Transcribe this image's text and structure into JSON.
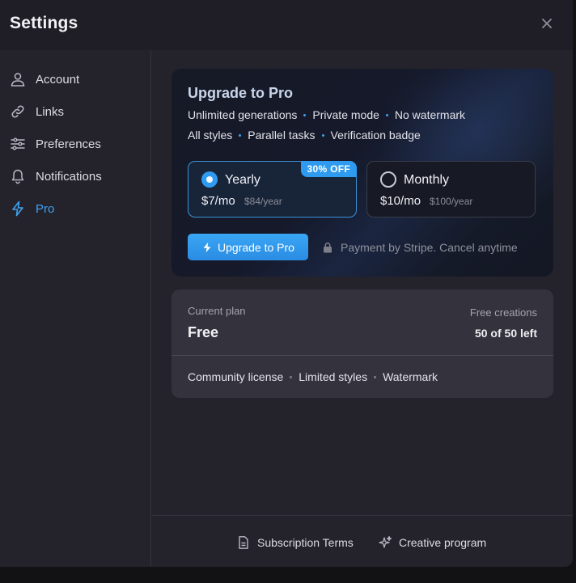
{
  "window": {
    "title": "Settings"
  },
  "sidebar": {
    "items": [
      {
        "label": "Account",
        "icon": "user-icon"
      },
      {
        "label": "Links",
        "icon": "link-icon"
      },
      {
        "label": "Preferences",
        "icon": "sliders-icon"
      },
      {
        "label": "Notifications",
        "icon": "bell-icon"
      },
      {
        "label": "Pro",
        "icon": "lightning-icon",
        "active": true
      }
    ]
  },
  "upgrade": {
    "title": "Upgrade to Pro",
    "features_row1": [
      "Unlimited generations",
      "Private mode",
      "No watermark"
    ],
    "features_row2": [
      "All styles",
      "Parallel tasks",
      "Verification badge"
    ],
    "plans": {
      "yearly": {
        "name": "Yearly",
        "price": "$7/mo",
        "year": "$84/year",
        "badge": "30% OFF",
        "selected": true
      },
      "monthly": {
        "name": "Monthly",
        "price": "$10/mo",
        "year": "$100/year",
        "selected": false
      }
    },
    "button_label": "Upgrade to Pro",
    "payment_note": "Payment by Stripe. Cancel anytime"
  },
  "current_plan": {
    "label": "Current plan",
    "name": "Free",
    "free_label": "Free creations",
    "free_count": "50 of 50 left",
    "features": [
      "Community license",
      "Limited styles",
      "Watermark"
    ]
  },
  "footer": {
    "terms_label": "Subscription Terms",
    "creative_label": "Creative program"
  },
  "colors": {
    "accent": "#2f9bf0",
    "background": "#24232c",
    "card": "#34333d"
  }
}
